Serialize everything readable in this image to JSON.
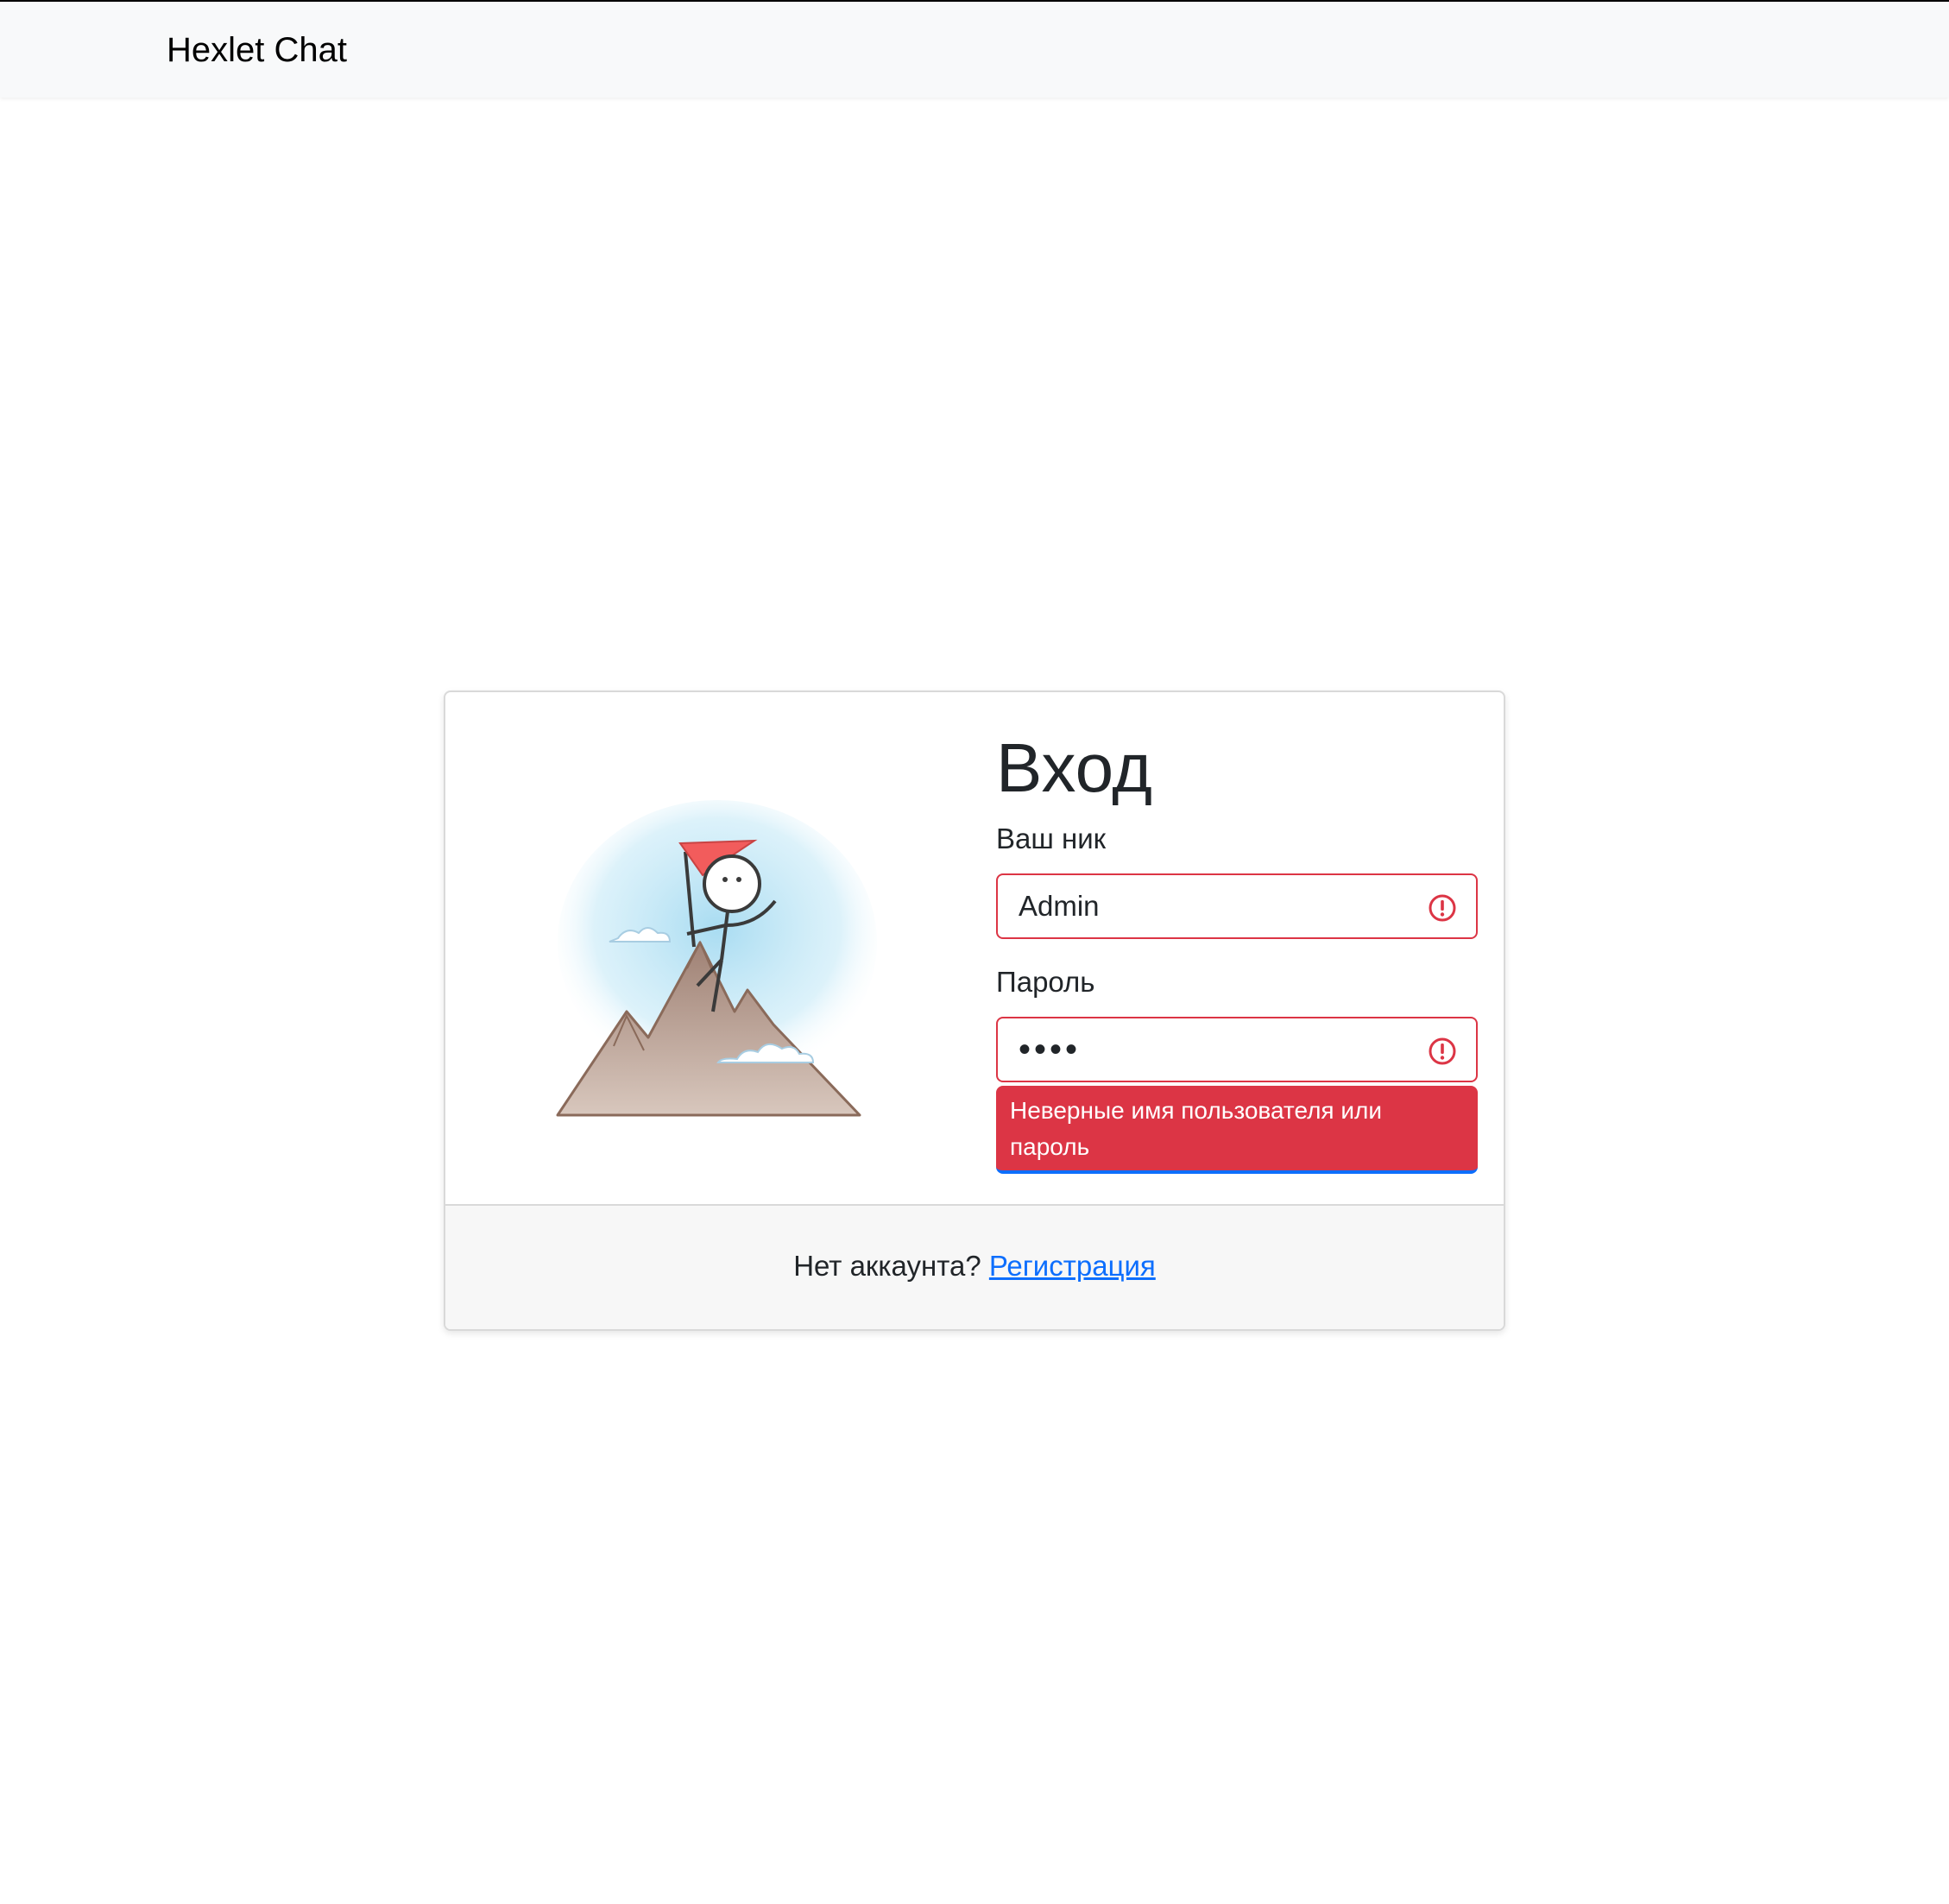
{
  "navbar": {
    "brand": "Hexlet Chat"
  },
  "login": {
    "title": "Вход",
    "username_label": "Ваш ник",
    "username_value": "Admin",
    "password_label": "Пароль",
    "password_value": "••••",
    "error_message": "Неверные имя пользователя или пароль"
  },
  "footer": {
    "prompt": "Нет аккаунта?",
    "signup_link": "Регистрация"
  },
  "colors": {
    "error": "#dc3545",
    "link": "#0d6efd",
    "navbar_bg": "#f8f9fa",
    "footer_bg": "#f7f7f7"
  },
  "icons": {
    "username_status": "exclamation-circle-icon",
    "password_status": "exclamation-circle-icon",
    "illustration": "mountain-climber-illustration"
  }
}
